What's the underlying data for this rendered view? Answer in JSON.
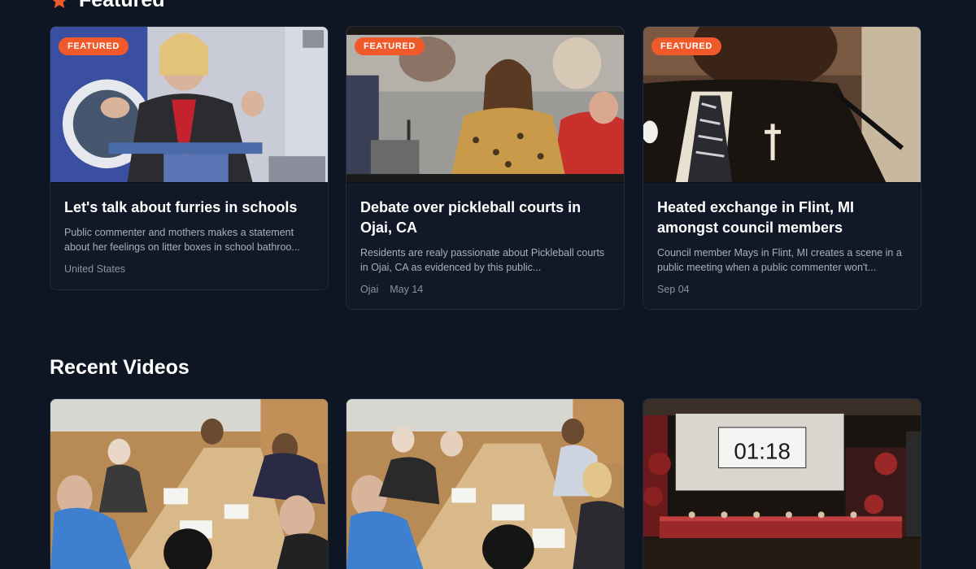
{
  "sections": {
    "featured_title": "Featured",
    "recent_title": "Recent Videos"
  },
  "colors": {
    "accent": "#f05a2a",
    "background": "#0e1523",
    "card": "#111827"
  },
  "featured": [
    {
      "badge": "FEATURED",
      "title": "Let's talk about furries in schools",
      "description": "Public commenter and mothers makes a statement about her feelings on litter boxes in school bathroo...",
      "location": "United States",
      "date": ""
    },
    {
      "badge": "FEATURED",
      "title": "Debate over pickleball courts in Ojai, CA",
      "description": "Residents are realy passionate about Pickleball courts in Ojai, CA as evidenced by this public...",
      "location": "Ojai",
      "date": "May 14"
    },
    {
      "badge": "FEATURED",
      "title": "Heated exchange in Flint, MI amongst council members",
      "description": "Council member Mays in Flint, MI creates a scene in a public meeting when a public commenter won't...",
      "location": "",
      "date": "Sep 04"
    }
  ],
  "recent": [
    {
      "thumbnail": "council-table-meeting"
    },
    {
      "thumbnail": "council-table-meeting"
    },
    {
      "thumbnail": "auditorium-timer",
      "timer_text": "01:18"
    }
  ]
}
